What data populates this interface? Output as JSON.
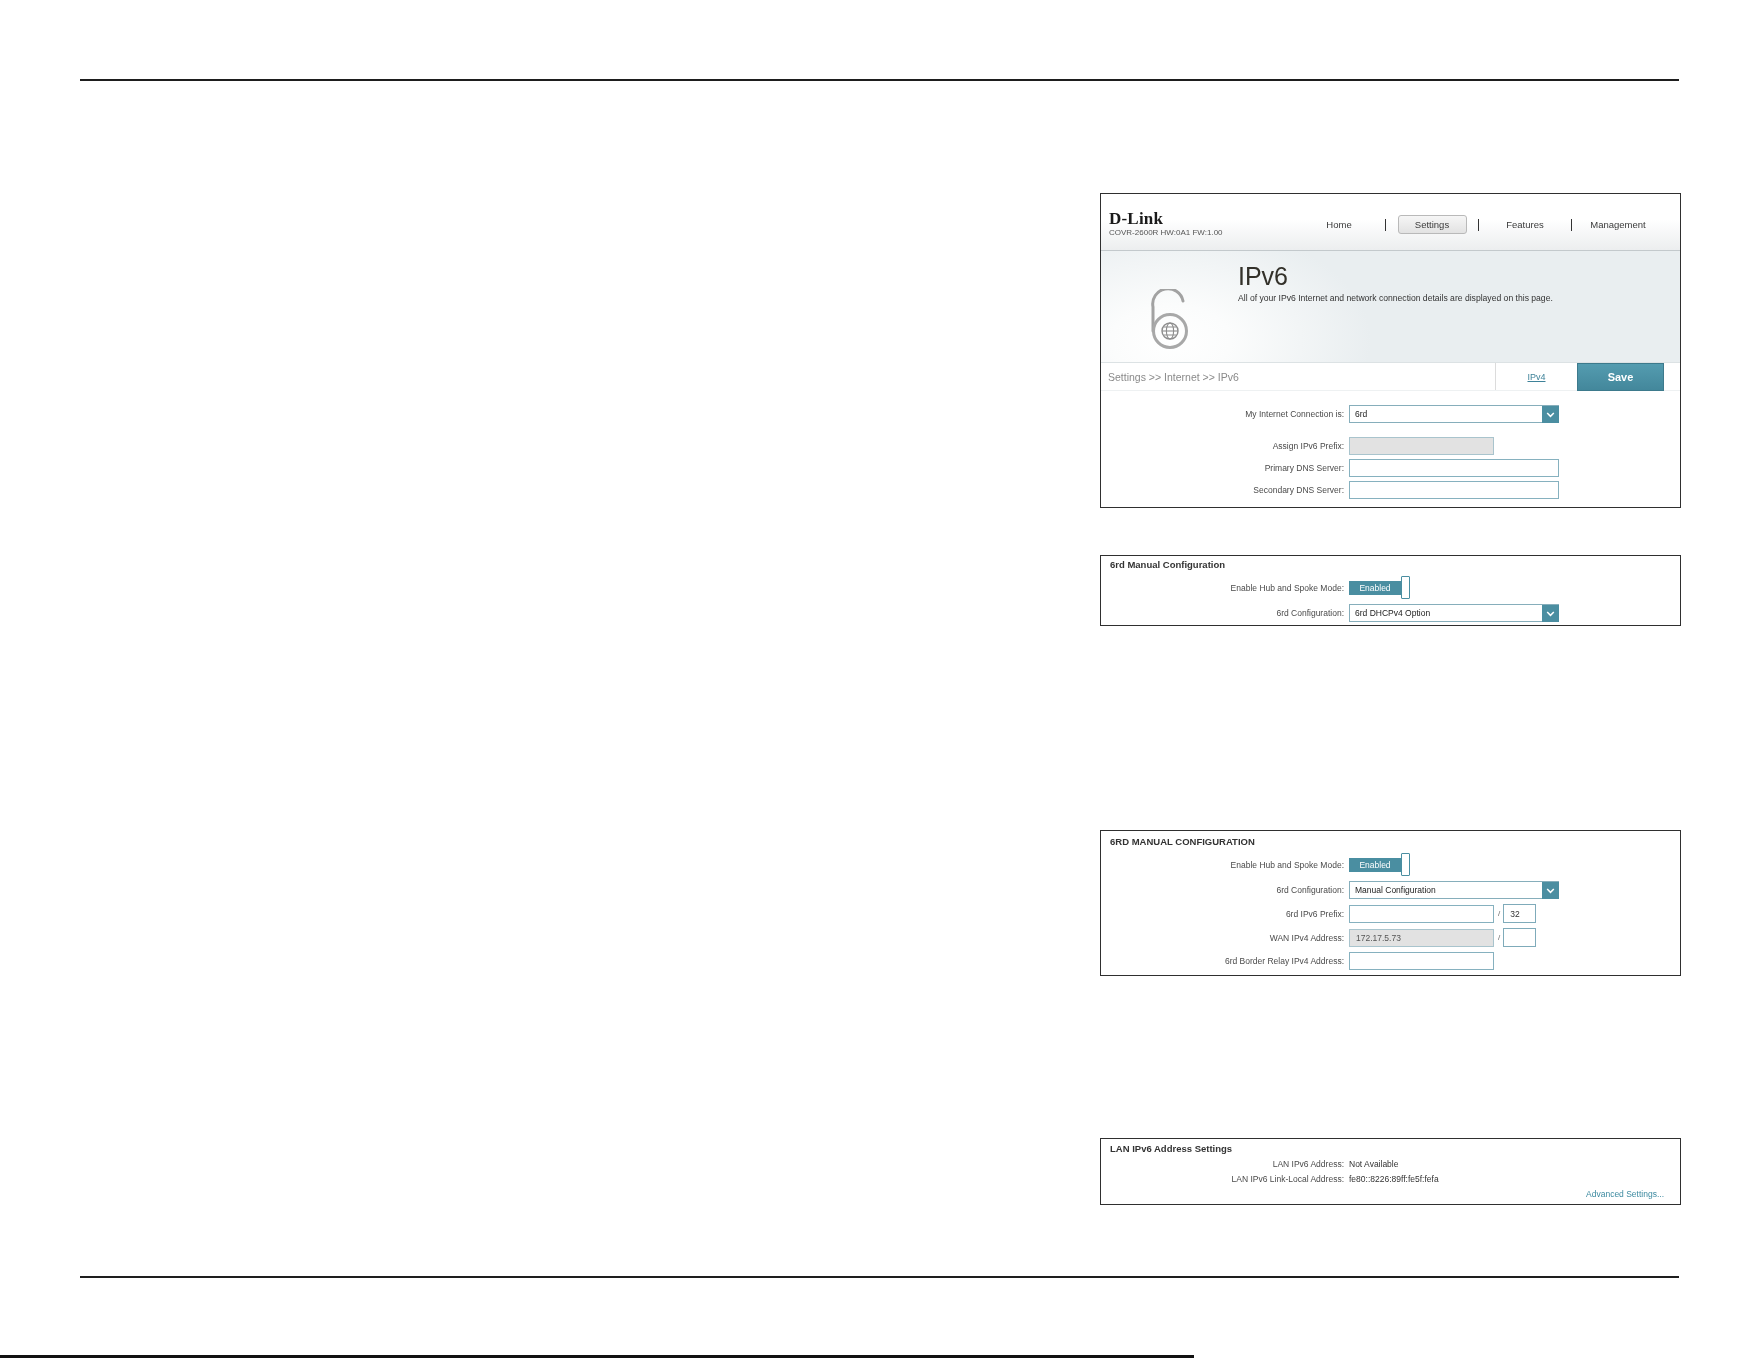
{
  "header": {
    "logo": "D-Link",
    "model": "COVR-2600R HW:0A1 FW:1.00",
    "nav": [
      {
        "label": "Home",
        "selected": false
      },
      {
        "label": "Settings",
        "selected": true
      },
      {
        "label": "Features",
        "selected": false
      },
      {
        "label": "Management",
        "selected": false
      }
    ]
  },
  "hero": {
    "title": "IPv6",
    "description": "All of your IPv6 Internet and network connection details are displayed on this page."
  },
  "toolbar": {
    "breadcrumb": "Settings >> Internet >> IPv6",
    "link": "IPv4",
    "save_button": "Save"
  },
  "connection_form": {
    "rows": [
      {
        "kind": "select",
        "label": "My Internet Connection is:",
        "value": "6rd"
      },
      {
        "kind": "short_input",
        "label": "Assign IPv6 Prefix:",
        "disabled": true
      },
      {
        "kind": "input",
        "label": "Primary DNS Server:",
        "disabled": false
      },
      {
        "kind": "input",
        "label": "Secondary DNS Server:",
        "disabled": false
      }
    ]
  },
  "sections": [
    {
      "title": "6rd Manual Configuration",
      "rows": [
        {
          "kind": "toggle",
          "label": "Enable Hub and Spoke Mode:",
          "value": "Enabled",
          "on": true
        },
        {
          "kind": "select",
          "label": "6rd Configuration:",
          "value": "6rd DHCPv4 Option"
        }
      ]
    },
    {
      "title": "6RD MANUAL CONFIGURATION",
      "rows": [
        {
          "kind": "toggle",
          "label": "Enable Hub and Spoke Mode:",
          "value": "Enabled",
          "on": true
        },
        {
          "kind": "select",
          "label": "6rd Configuration:",
          "value": "Manual Configuration"
        },
        {
          "kind": "prefix_input",
          "label": "6rd IPv6 Prefix:",
          "disabled": false,
          "separator": "/",
          "length": "32"
        },
        {
          "kind": "prefix_input",
          "label": "WAN IPv4 Address:",
          "disabled": true,
          "value": "172.17.5.73",
          "separator": "/"
        },
        {
          "kind": "short_input",
          "label": "6rd Border Relay IPv4 Address:",
          "disabled": false
        }
      ]
    },
    {
      "title": "LAN IPv6 Address Settings",
      "rows": [
        {
          "kind": "info",
          "label": "LAN IPv6 Address:",
          "value": "Not Available"
        },
        {
          "kind": "info",
          "label": "LAN IPv6 Link-Local Address:",
          "value": "fe80::8226:89ff:fe5f:fefa"
        }
      ],
      "link": "Advanced Settings..."
    }
  ]
}
